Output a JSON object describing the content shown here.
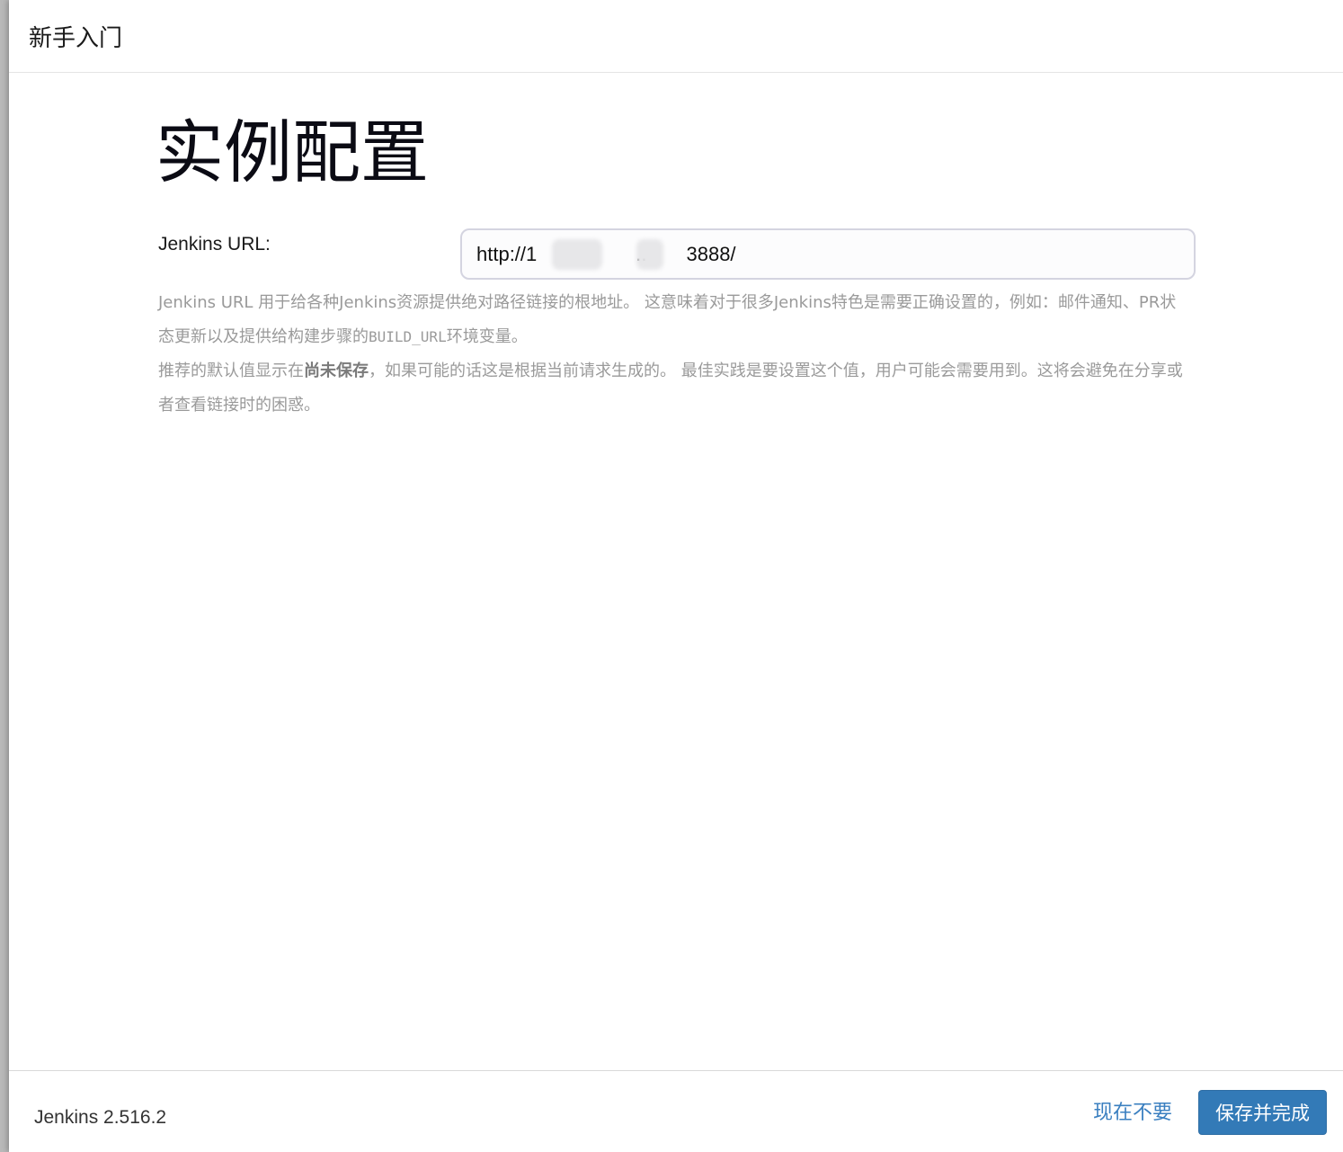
{
  "header": {
    "title": "新手入门"
  },
  "main": {
    "title": "实例配置",
    "url_label": "Jenkins URL:",
    "url_value": "http://1     ..  3888/",
    "help": {
      "para1": "Jenkins URL 用于给各种Jenkins资源提供绝对路径链接的根地址。 这意味着对于很多Jenkins特色是需要正确设置的，例如：邮件通知、PR状态更新以及提供给构建步骤的",
      "code": "BUILD_URL",
      "para1_end": "环境变量。",
      "para2_start": "推荐的默认值显示在",
      "para2_bold": "尚未保存",
      "para2_end": "，如果可能的话这是根据当前请求生成的。 最佳实践是要设置这个值，用户可能会需要用到。这将会避免在分享或者查看链接时的困惑。"
    }
  },
  "footer": {
    "version": "Jenkins 2.516.2",
    "skip_label": "现在不要",
    "save_label": "保存并完成"
  },
  "colors": {
    "primary": "#337ab7",
    "link": "#3a7fc0",
    "help_text": "#9a9a9a"
  }
}
